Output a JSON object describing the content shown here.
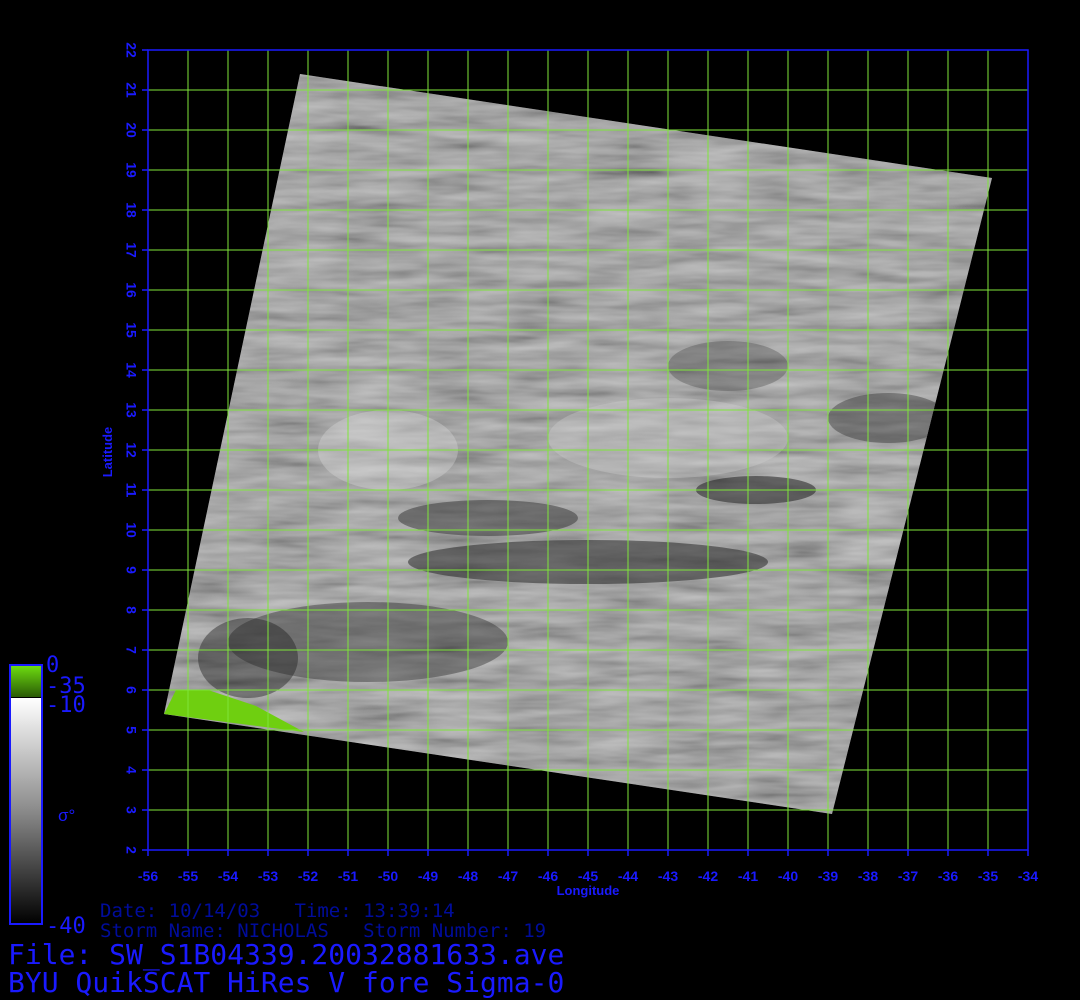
{
  "colors": {
    "grid": "#7fe63a",
    "axis": "#1a1aff",
    "land": "#6fcf10",
    "background": "#000000"
  },
  "chart_data": {
    "type": "heatmap",
    "xlabel": "Longitude",
    "ylabel": "Latitude",
    "xlim": [
      -56,
      -34
    ],
    "ylim": [
      2,
      22
    ],
    "x_ticks": [
      -56,
      -55,
      -54,
      -53,
      -52,
      -51,
      -50,
      -49,
      -48,
      -47,
      -46,
      -45,
      -44,
      -43,
      -42,
      -41,
      -40,
      -39,
      -38,
      -37,
      -36,
      -35,
      -34
    ],
    "y_ticks": [
      2,
      3,
      4,
      5,
      6,
      7,
      8,
      9,
      10,
      11,
      12,
      13,
      14,
      15,
      16,
      17,
      18,
      19,
      20,
      21,
      22
    ],
    "grid": true,
    "swath_corners_lonlat": [
      [
        -52.2,
        21.4
      ],
      [
        -34.9,
        18.8
      ],
      [
        -38.9,
        2.9
      ],
      [
        -55.6,
        5.4
      ]
    ],
    "colorbar": {
      "symbol": "σ°",
      "labels": [
        "0",
        "-35",
        "-10",
        "-40"
      ],
      "position": "bottom-left"
    }
  },
  "info": {
    "date_line": "Date: 10/14/03   Time: 13:39:14",
    "storm_line": "Storm Name: NICHOLAS   Storm Number: 19",
    "file_line": "File: SW_S1B04339.20032881633.ave",
    "source_line": "BYU QuikSCAT HiRes V fore Sigma-0"
  }
}
